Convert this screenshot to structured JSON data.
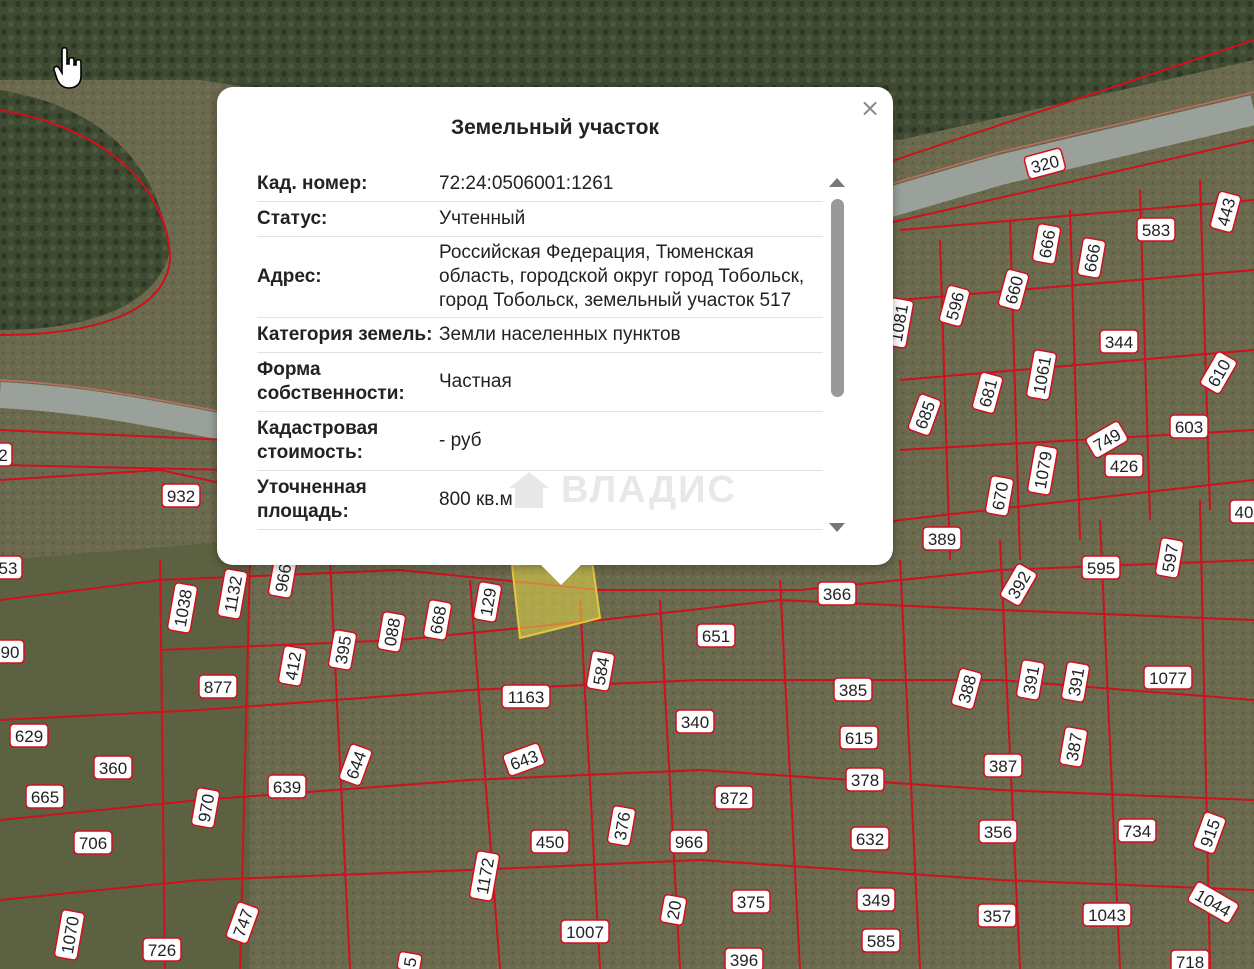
{
  "popup": {
    "title": "Земельный участок",
    "close_label": "×",
    "rows": [
      {
        "key": "Кад. номер:",
        "value": "72:24:0506001:1261"
      },
      {
        "key": "Статус:",
        "value": "Учтенный"
      },
      {
        "key": "Адрес:",
        "value": "Российская Федерация, Тюменская область, городской округ город Тобольск, город Тобольск, земельный участок 517"
      },
      {
        "key": "Категория земель:",
        "value": "Земли населенных пунктов"
      },
      {
        "key": "Форма собственности:",
        "value": "Частная"
      },
      {
        "key": "Кадастровая стоимость:",
        "value": "- руб"
      },
      {
        "key": "Уточненная площадь:",
        "value": "800 кв.м"
      }
    ],
    "watermark": "ВЛАДИС"
  },
  "map": {
    "colors": {
      "boundary": "#d0101e",
      "label_bg": "#ffffff",
      "highlight": "#e8d84a",
      "road": "#9aa19a"
    },
    "plot_labels": [
      "320",
      "443",
      "583",
      "666",
      "666",
      "596",
      "660",
      "1081",
      "344",
      "610",
      "685",
      "681",
      "1061",
      "749",
      "426",
      "603",
      "1079",
      "670",
      "2",
      "932",
      "53",
      "389",
      "392",
      "595",
      "597",
      "40",
      "1038",
      "1132",
      "966",
      "129",
      "366",
      "90",
      "877",
      "412",
      "395",
      "088",
      "668",
      "1163",
      "584",
      "651",
      "385",
      "388",
      "391",
      "391",
      "1077",
      "629",
      "360",
      "643",
      "340",
      "615",
      "387",
      "387",
      "665",
      "970",
      "639",
      "644",
      "378",
      "706",
      "1172",
      "450",
      "376",
      "966",
      "872",
      "632",
      "356",
      "734",
      "915",
      "1070",
      "726",
      "747",
      "1007",
      "20",
      "375",
      "349",
      "357",
      "1043",
      "1044",
      "585",
      "396",
      "718",
      "5"
    ]
  }
}
